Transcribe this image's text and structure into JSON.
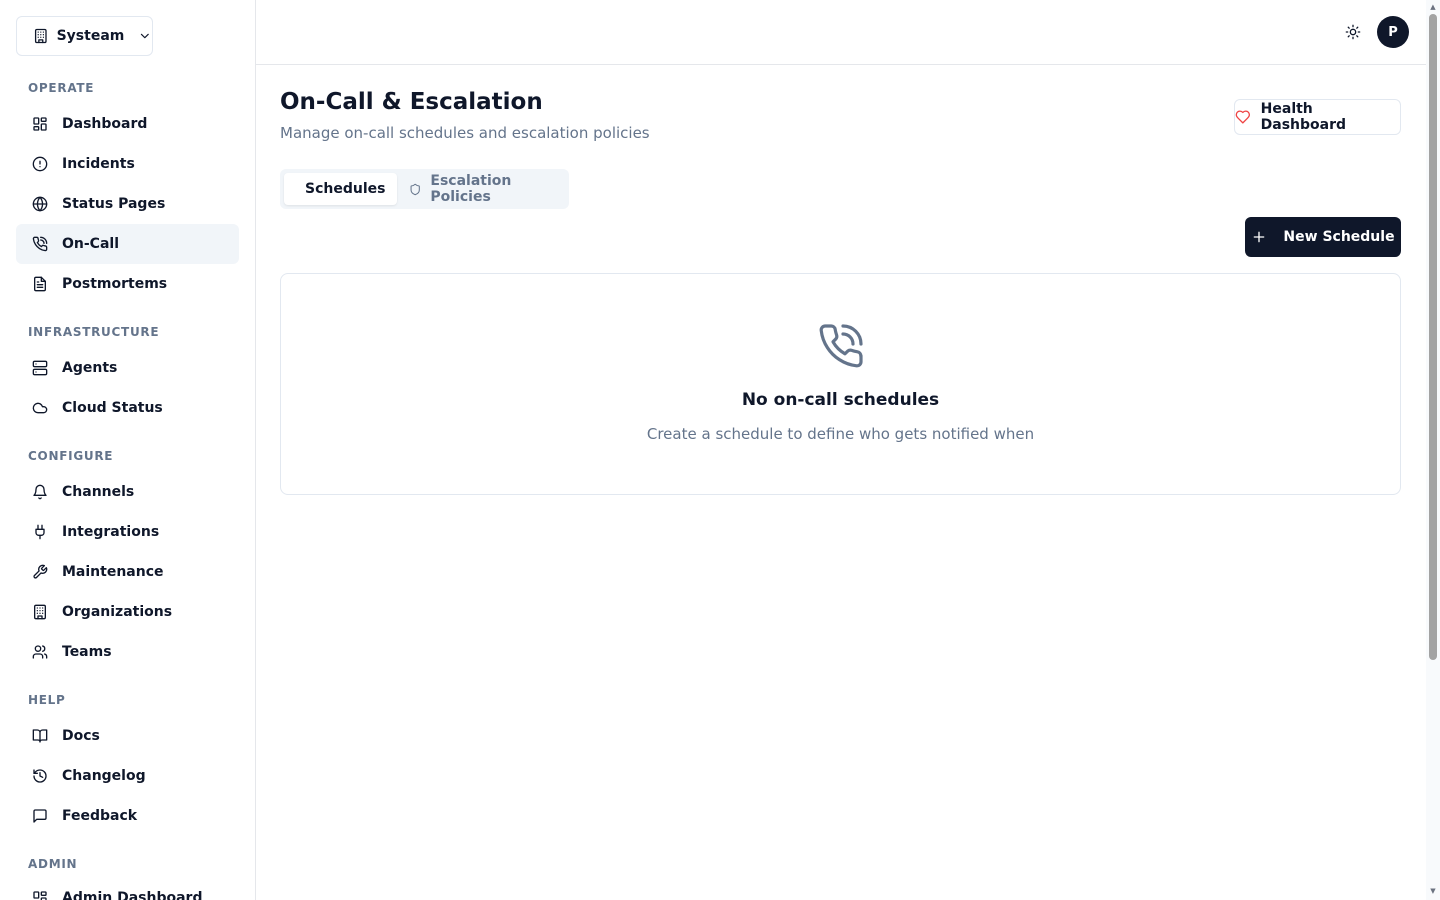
{
  "org_switcher": {
    "name": "Systeam",
    "icon": "building-icon"
  },
  "sidebar": {
    "sections": [
      {
        "label": "OPERATE",
        "items": [
          {
            "label": "Dashboard",
            "icon": "layout-grid-icon",
            "active": false
          },
          {
            "label": "Incidents",
            "icon": "alert-circle-icon",
            "active": false
          },
          {
            "label": "Status Pages",
            "icon": "globe-icon",
            "active": false
          },
          {
            "label": "On-Call",
            "icon": "phone-call-icon",
            "active": true
          },
          {
            "label": "Postmortems",
            "icon": "file-text-icon",
            "active": false
          }
        ]
      },
      {
        "label": "INFRASTRUCTURE",
        "items": [
          {
            "label": "Agents",
            "icon": "server-icon",
            "active": false
          },
          {
            "label": "Cloud Status",
            "icon": "cloud-icon",
            "active": false
          }
        ]
      },
      {
        "label": "CONFIGURE",
        "items": [
          {
            "label": "Channels",
            "icon": "bell-icon",
            "active": false
          },
          {
            "label": "Integrations",
            "icon": "plug-icon",
            "active": false
          },
          {
            "label": "Maintenance",
            "icon": "wrench-icon",
            "active": false
          },
          {
            "label": "Organizations",
            "icon": "building-icon",
            "active": false
          },
          {
            "label": "Teams",
            "icon": "users-icon",
            "active": false
          }
        ]
      },
      {
        "label": "HELP",
        "items": [
          {
            "label": "Docs",
            "icon": "book-open-icon",
            "active": false
          },
          {
            "label": "Changelog",
            "icon": "history-icon",
            "active": false
          },
          {
            "label": "Feedback",
            "icon": "message-square-icon",
            "active": false
          }
        ]
      },
      {
        "label": "ADMIN",
        "items": [
          {
            "label": "Admin Dashboard",
            "icon": "layout-grid-icon",
            "active": false
          }
        ]
      }
    ]
  },
  "topbar": {
    "theme_icon": "sun-icon",
    "avatar_initial": "P"
  },
  "page": {
    "title": "On-Call & Escalation",
    "subtitle": "Manage on-call schedules and escalation policies",
    "health_button": "Health Dashboard"
  },
  "tabs": [
    {
      "label": "Schedules",
      "icon": "phone-call-icon",
      "active": true
    },
    {
      "label": "Escalation Policies",
      "icon": "shield-icon",
      "active": false
    }
  ],
  "actions": {
    "new_schedule": "New Schedule"
  },
  "empty_state": {
    "icon": "phone-call-icon",
    "title": "No on-call schedules",
    "description": "Create a schedule to define who gets notified when"
  },
  "colors": {
    "primary": "#0f172a",
    "muted": "#64748b",
    "border": "#e2e8f0",
    "active_bg": "#f1f5f9",
    "heart": "#ef4444"
  }
}
